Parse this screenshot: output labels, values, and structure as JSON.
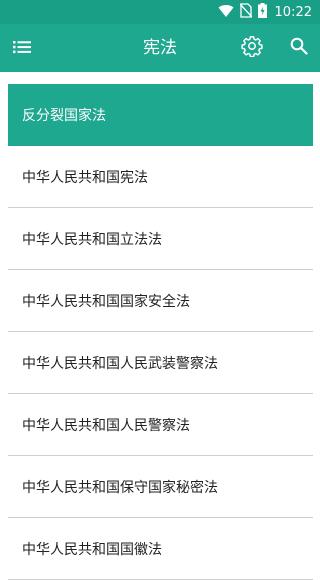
{
  "status_bar": {
    "time": "10:22",
    "icons": [
      "wifi-icon",
      "no-sim-icon",
      "battery-charging-icon"
    ]
  },
  "app_bar": {
    "title": "宪法",
    "menu_icon": "menu-icon",
    "settings_icon": "gear-icon",
    "search_icon": "search-icon"
  },
  "colors": {
    "primary": "#1fa890",
    "primary_dark": "#1a9f87",
    "text": "#222222",
    "divider": "#cfcfcf"
  },
  "laws": [
    {
      "label": "反分裂国家法",
      "selected": true
    },
    {
      "label": "中华人民共和国宪法",
      "selected": false
    },
    {
      "label": "中华人民共和国立法法",
      "selected": false
    },
    {
      "label": "中华人民共和国国家安全法",
      "selected": false
    },
    {
      "label": "中华人民共和国人民武装警察法",
      "selected": false
    },
    {
      "label": "中华人民共和国人民警察法",
      "selected": false
    },
    {
      "label": "中华人民共和国保守国家秘密法",
      "selected": false
    },
    {
      "label": "中华人民共和国国徽法",
      "selected": false
    }
  ]
}
